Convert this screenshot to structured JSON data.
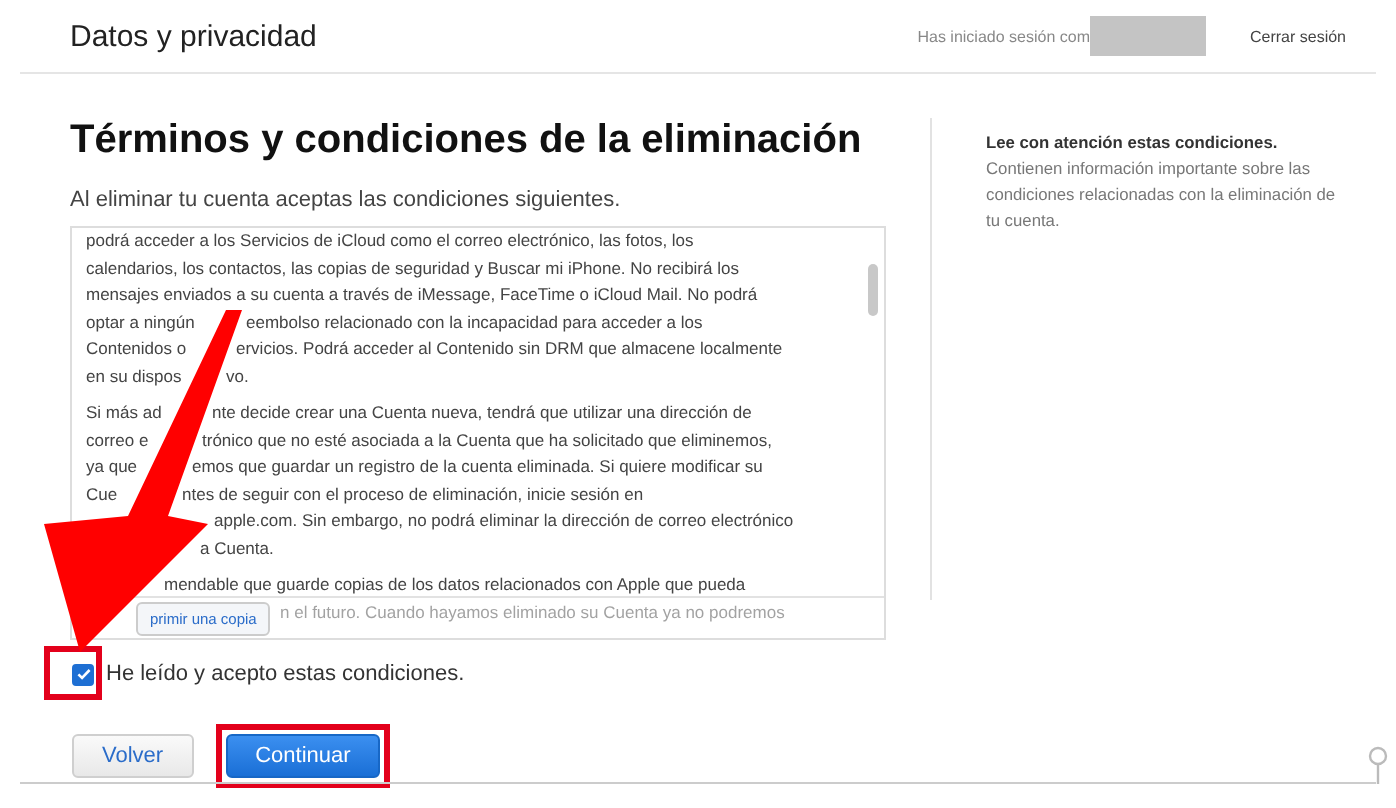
{
  "header": {
    "title": "Datos y privacidad",
    "signed_in_label": "Has iniciado sesión com",
    "sign_out": "Cerrar sesión"
  },
  "page": {
    "title": "Términos y condiciones de la eliminación",
    "intro": "Al eliminar tu cuenta aceptas las condiciones siguientes.",
    "terms": [
      [
        {
          "text": "podrá acceder a los Servicios de iCloud como el correo electrónico, las fotos, los"
        },
        {
          "text": "calendarios, los contactos, las copias de seguridad y Buscar mi iPhone. No recibirá los"
        },
        {
          "text": "mensajes enviados a su cuenta a través de iMessage, FaceTime o iCloud Mail. No podrá"
        },
        {
          "left": "optar a ningún",
          "right": "eembolso relacionado con la incapacidad para acceder a los"
        },
        {
          "left": "Contenidos o",
          "right": "ervicios. Podrá acceder al Contenido sin DRM que almacene localmente"
        },
        {
          "left": "en su dispos",
          "right": "vo."
        }
      ],
      [
        {
          "left": "Si más ad",
          "right": "nte decide crear una Cuenta nueva, tendrá que utilizar una dirección de"
        },
        {
          "left": "correo e",
          "right": "trónico que no esté asociada a la Cuenta que ha solicitado que eliminemos,"
        },
        {
          "left": "ya que",
          "right": "emos que guardar un registro de la cuenta eliminada. Si quiere modificar su"
        },
        {
          "left": "Cue",
          "right": "ntes de seguir con el proceso de eliminación, inicie sesión en"
        },
        {
          "right": "apple.com. Sin embargo, no podrá eliminar la dirección de correo electrónico"
        },
        {
          "right": "a Cuenta."
        }
      ],
      [
        {
          "right": "mendable que guarde copias de los datos relacionados con Apple que pueda"
        },
        {
          "right": "n el futuro. Cuando hayamos eliminado su Cuenta ya no podremos"
        }
      ]
    ],
    "print_button": "primir una copia",
    "sidebar": {
      "heading": "Lee con atención estas condiciones.",
      "body": "Contienen información importante sobre las condiciones relacionadas con la eliminación de tu cuenta."
    },
    "agree": {
      "label": "He leído y acepto estas condiciones.",
      "checked": true,
      "highlighted": true
    },
    "buttons": [
      {
        "label": "Volver",
        "kind": "secondary",
        "highlighted": false
      },
      {
        "label": "Continuar",
        "kind": "primary",
        "highlighted": true
      }
    ]
  }
}
